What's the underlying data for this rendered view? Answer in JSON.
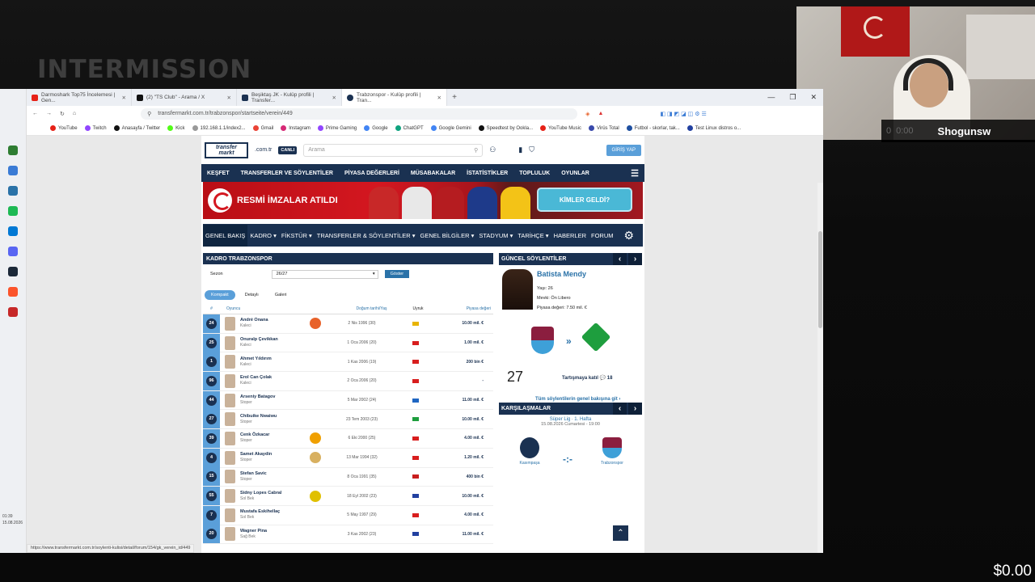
{
  "stream": {
    "intermission": "INTERMISSION",
    "streamer": "Shogunsw",
    "cam_time": "0:00",
    "cam_count": "0",
    "money": "$0.00"
  },
  "browser": {
    "tabs": [
      {
        "label": "Darmoshark Top75 İncelemesi | Gen...",
        "color": "#e62117"
      },
      {
        "label": "(2) \"TS Club\" - Arama / X",
        "color": "#111111"
      },
      {
        "label": "Beşiktaş JK - Kulüp profili | Transfer...",
        "color": "#1a3151"
      },
      {
        "label": "Trabzonspor - Kulüp profili | Tran...",
        "color": "#1a3151"
      }
    ],
    "url": "transfermarkt.com.tr/trabzonspor/startseite/verein/449",
    "bookmarks": [
      "YouTube",
      "Twitch",
      "Anasayfa / Twitter",
      "Kick",
      "192.168.1.1/index2...",
      "Gmail",
      "Instagram",
      "Prime Gaming",
      "Google",
      "ChatGPT",
      "Google Gemini",
      "Speedtest by Ookla...",
      "YouTube Music",
      "Virüs Total",
      "Futbol - skorlar, tak...",
      "Test Linux distros o..."
    ],
    "status_url": "https://www.transfermarkt.com.tr/soylenti-kulisi/detail/forum/154/gk_verein_id/449"
  },
  "site": {
    "tld": ".com.tr",
    "canli": "CANLI",
    "search_placeholder": "Arama",
    "giris": "GİRİŞ YAP",
    "nav": [
      "KEŞFET",
      "TRANSFERLER VE SÖYLENTİLER",
      "PİYASA DEĞERLERİ",
      "MÜSABAKALAR",
      "İSTATİSTİKLER",
      "TOPLULUK",
      "OYUNLAR"
    ],
    "banner_title": "RESMİ İMZALAR ATILDI",
    "banner_cta": "KİMLER GELDİ?",
    "subnav": [
      "GENEL BAKIŞ",
      "KADRO ▾",
      "FİKSTÜR ▾",
      "TRANSFERLER & SÖYLENTİLER ▾",
      "GENEL BİLGİLER ▾",
      "STADYUM ▾",
      "TARİHÇE ▾",
      "HABERLER",
      "FORUM"
    ]
  },
  "squad": {
    "title": "KADRO TRABZONSPOR",
    "sezon_label": "Sezon",
    "sezon_value": "26/27",
    "goster": "Göster",
    "tabs": [
      "Kompakt",
      "Detaylı",
      "Galeri"
    ],
    "cols": [
      "#",
      "Oyuncu",
      "Doğum tarihi/Yaş",
      "Uyruk",
      "Piyasa değeri"
    ],
    "players": [
      {
        "no": "24",
        "name": "André Onana",
        "pos": "Kaleci",
        "dob": "2 Nis 1996 (30)",
        "value": "10.00 mil. €",
        "club": "#e8622a",
        "flag": "#e8b400"
      },
      {
        "no": "25",
        "name": "Onuralp Çevikkan",
        "pos": "Kaleci",
        "dob": "1 Oca 2006 (20)",
        "value": "1.00 mil. €",
        "club": "",
        "flag": "#d81e1e"
      },
      {
        "no": "1",
        "name": "Ahmet Yıldırım",
        "pos": "Kaleci",
        "dob": "1 Kas 2006 (19)",
        "value": "200 bin €",
        "club": "",
        "flag": "#d81e1e"
      },
      {
        "no": "96",
        "name": "Erol Can Çolak",
        "pos": "Kaleci",
        "dob": "2 Oca 2006 (20)",
        "value": "-",
        "club": "",
        "flag": "#d81e1e"
      },
      {
        "no": "44",
        "name": "Arseniy Batagov",
        "pos": "Stoper",
        "dob": "5 Mar 2002 (24)",
        "value": "11.00 mil. €",
        "club": "",
        "flag": "#1f66c2"
      },
      {
        "no": "27",
        "name": "Chibuike Nwaiwu",
        "pos": "Stoper",
        "dob": "23 Tem 2003 (23)",
        "value": "10.00 mil. €",
        "club": "",
        "flag": "#1e9e3e"
      },
      {
        "no": "39",
        "name": "Cenk Özkacar",
        "pos": "Stoper",
        "dob": "6 Eki 2000 (25)",
        "value": "4.00 mil. €",
        "club": "#f0a000",
        "flag": "#d81e1e"
      },
      {
        "no": "4",
        "name": "Samet Akaydin",
        "pos": "Stoper",
        "dob": "13 Mar 1994 (32)",
        "value": "1.20 mil. €",
        "club": "#d8b060",
        "flag": "#d81e1e"
      },
      {
        "no": "15",
        "name": "Stefan Savic",
        "pos": "Stoper",
        "dob": "8 Oca 1991 (35)",
        "value": "400 bin €",
        "club": "",
        "flag": "#c81e1e"
      },
      {
        "no": "55",
        "name": "Sidny Lopes Cabral",
        "pos": "Sol Bek",
        "dob": "18 Eyl 2002 (23)",
        "value": "10.00 mil. €",
        "club": "#e0c000",
        "flag": "#2240a0"
      },
      {
        "no": "7",
        "name": "Mustafa Eskihellaç",
        "pos": "Sol Bek",
        "dob": "5 May 1997 (29)",
        "value": "4.00 mil. €",
        "club": "",
        "flag": "#d81e1e"
      },
      {
        "no": "20",
        "name": "Wagner Pina",
        "pos": "Sağ Bek",
        "dob": "3 Kas 2002 (23)",
        "value": "11.00 mil. €",
        "club": "",
        "flag": "#2240a0"
      }
    ]
  },
  "rumors": {
    "title": "GÜNCEL SÖYLENTİLER",
    "player": "Batista Mendy",
    "age": "Yaşı: 26",
    "position": "Mevki: Ön Libero",
    "market_value": "Piyasa değeri: 7.50 mil. €",
    "probability": "27",
    "discuss": "Tartışmaya katıl",
    "comments": "18",
    "all_link": "Tüm söylentilerin genel bakışına git"
  },
  "matches": {
    "title": "KARŞILAŞMALAR",
    "league": "Süper Lig",
    "week": "1. Hafta",
    "date": "15.08.2026 Cumartesi - 19:00",
    "home": "Kasımpaşa",
    "away": "Trabzonspor",
    "score": "-:-"
  },
  "taskbar": {
    "time": "01:39",
    "date": "15.08.2026"
  }
}
